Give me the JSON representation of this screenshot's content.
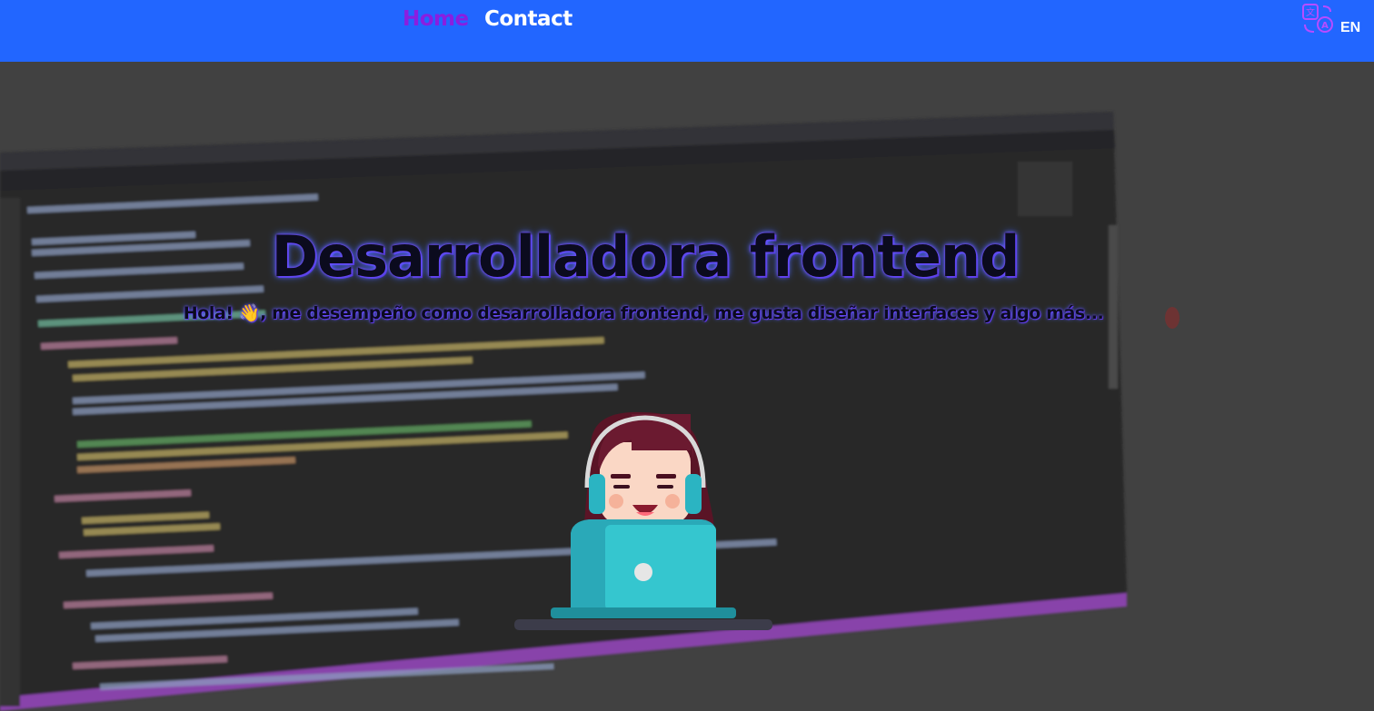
{
  "nav": {
    "home_label": "Home",
    "contact_label": "Contact",
    "language_icon": "translate-icon",
    "language_code": "EN"
  },
  "hero": {
    "title": "Desarrolladora frontend",
    "subtitle": "Hola! 👋, me desempeño como desarrolladora frontend, me gusta diseñar interfaces y algo más...",
    "background_icon": "code-editor-screen-photo",
    "illustration_icon": "developer-girl-laptop-illustration"
  },
  "colors": {
    "navbar": "#2266ff",
    "active_link": "#8a1ee0",
    "link": "#ffffff",
    "title_glow": "#6c5cff"
  }
}
